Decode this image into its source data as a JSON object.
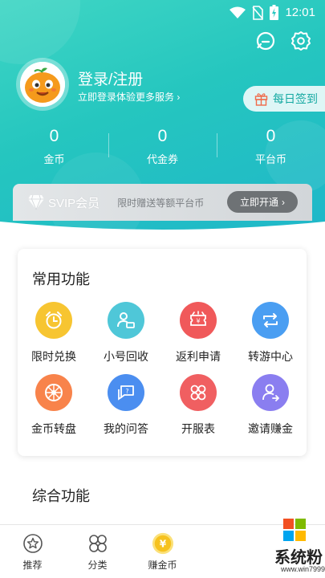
{
  "status_bar": {
    "time": "12:01",
    "icons": [
      "wifi-icon",
      "no-sim-icon",
      "battery-charging-icon"
    ]
  },
  "header": {
    "icons": [
      "chat-icon",
      "gear-icon"
    ],
    "login_title": "登录/注册",
    "login_subtitle": "立即登录体验更多服务",
    "checkin_label": "每日签到"
  },
  "stats": [
    {
      "value": "0",
      "label": "金币"
    },
    {
      "value": "0",
      "label": "代金券"
    },
    {
      "value": "0",
      "label": "平台币"
    }
  ],
  "svip": {
    "title": "SVIP会员",
    "desc": "限时赠送等额平台币",
    "button": "立即开通"
  },
  "common_functions": {
    "title": "常用功能",
    "items": [
      {
        "label": "限时兑换",
        "icon": "alarm-clock-icon",
        "color": "#f7c531"
      },
      {
        "label": "小号回收",
        "icon": "account-recycle-icon",
        "color": "#4fc7d8"
      },
      {
        "label": "返利申请",
        "icon": "rebate-ticket-icon",
        "color": "#f0595a"
      },
      {
        "label": "转游中心",
        "icon": "transfer-arrows-icon",
        "color": "#4a9ef2"
      },
      {
        "label": "金币转盘",
        "icon": "wheel-icon",
        "color": "#f8834b"
      },
      {
        "label": "我的问答",
        "icon": "question-chat-icon",
        "color": "#4b8ef0"
      },
      {
        "label": "开服表",
        "icon": "grid-circles-icon",
        "color": "#f05f61"
      },
      {
        "label": "邀请赚金",
        "icon": "invite-user-icon",
        "color": "#8a7ef0"
      }
    ]
  },
  "section2": {
    "title": "综合功能"
  },
  "bottom_nav": [
    {
      "label": "推荐",
      "icon": "star-icon"
    },
    {
      "label": "分类",
      "icon": "category-icon"
    },
    {
      "label": "赚金币",
      "icon": "yen-coin-icon"
    }
  ],
  "watermark": {
    "text": "系统粉",
    "url": "www.win7999.com"
  }
}
